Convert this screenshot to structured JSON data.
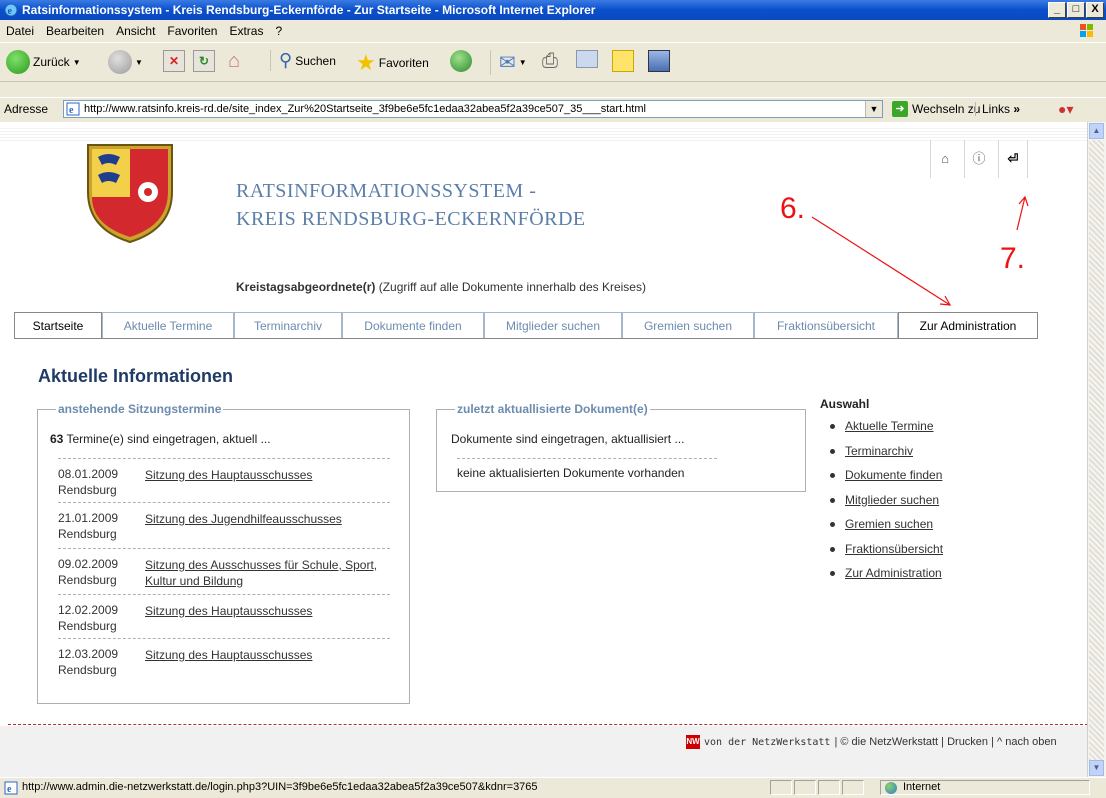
{
  "window": {
    "title": "Ratsinformationssystem - Kreis Rendsburg-Eckernförde - Zur Startseite - Microsoft Internet Explorer",
    "buttons": [
      "_",
      "□",
      "X"
    ]
  },
  "menu": [
    "Datei",
    "Bearbeiten",
    "Ansicht",
    "Favoriten",
    "Extras",
    "?"
  ],
  "toolbar": {
    "back_label": "Zurück",
    "search_label": "Suchen",
    "favorites_label": "Favoriten"
  },
  "address": {
    "label": "Adresse",
    "url": "http://www.ratsinfo.kreis-rd.de/site_index_Zur%20Startseite_3f9be6e5fc1edaa32abea5f2a39ce507_35___start.html",
    "go_label": "Wechseln zu",
    "links_label": "Links"
  },
  "site": {
    "title_line1": "RATSINFORMATIONSSYSTEM -",
    "title_line2": "KREIS RENDSBURG-ECKERNFÖRDE",
    "role_bold": "Kreistagsabgeordnete(r)",
    "role_text": " (Zugriff auf alle Dokumente innerhalb des Kreises)",
    "header_icons": [
      "home-icon",
      "info-icon",
      "logout-icon"
    ]
  },
  "tabs": [
    "Startseite",
    "Aktuelle Termine",
    "Terminarchiv",
    "Dokumente finden",
    "Mitglieder suchen",
    "Gremien suchen",
    "Fraktionsübersicht",
    "Zur Administration"
  ],
  "main": {
    "heading": "Aktuelle Informationen",
    "sessions": {
      "legend": "anstehende Sitzungstermine",
      "count": "63",
      "count_text": " Termine(e) sind eingetragen, aktuell ...",
      "items": [
        {
          "date": "08.01.2009",
          "place": "Rendsburg",
          "title": "Sitzung des Hauptausschusses"
        },
        {
          "date": "21.01.2009",
          "place": "Rendsburg",
          "title": "Sitzung des Jugendhilfeausschusses"
        },
        {
          "date": "09.02.2009",
          "place": "Rendsburg",
          "title": "Sitzung des Ausschusses für Schule, Sport, Kultur und Bildung"
        },
        {
          "date": "12.02.2009",
          "place": "Rendsburg",
          "title": "Sitzung des Hauptausschusses"
        },
        {
          "date": "12.03.2009",
          "place": "Rendsburg",
          "title": "Sitzung des Hauptausschusses"
        }
      ]
    },
    "documents": {
      "legend": "zuletzt aktuallisierte Dokument(e)",
      "line1": "Dokumente sind eingetragen, aktuallisiert ...",
      "line2": "keine aktualisierten Dokumente vorhanden"
    },
    "auswahl": {
      "title": "Auswahl",
      "items": [
        "Aktuelle Termine",
        "Terminarchiv",
        "Dokumente finden",
        "Mitglieder suchen",
        "Gremien suchen",
        "Fraktionsübersicht",
        "Zur Administration"
      ]
    }
  },
  "annotations": {
    "six": "6.",
    "seven": "7."
  },
  "footer": {
    "brand": "von der NetzWerkstatt",
    "text": " | © die NetzWerkstatt | Drucken | ^ nach oben"
  },
  "status": {
    "url": "http://www.admin.die-netzwerkstatt.de/login.php3?UIN=3f9be6e5fc1edaa32abea5f2a39ce507&kdnr=3765",
    "zone": "Internet"
  },
  "colors": {
    "accent": "#6C8CAE",
    "title_blue": "#5B7FA8",
    "heading": "#1F3B66",
    "annotation": "#EE1111"
  }
}
